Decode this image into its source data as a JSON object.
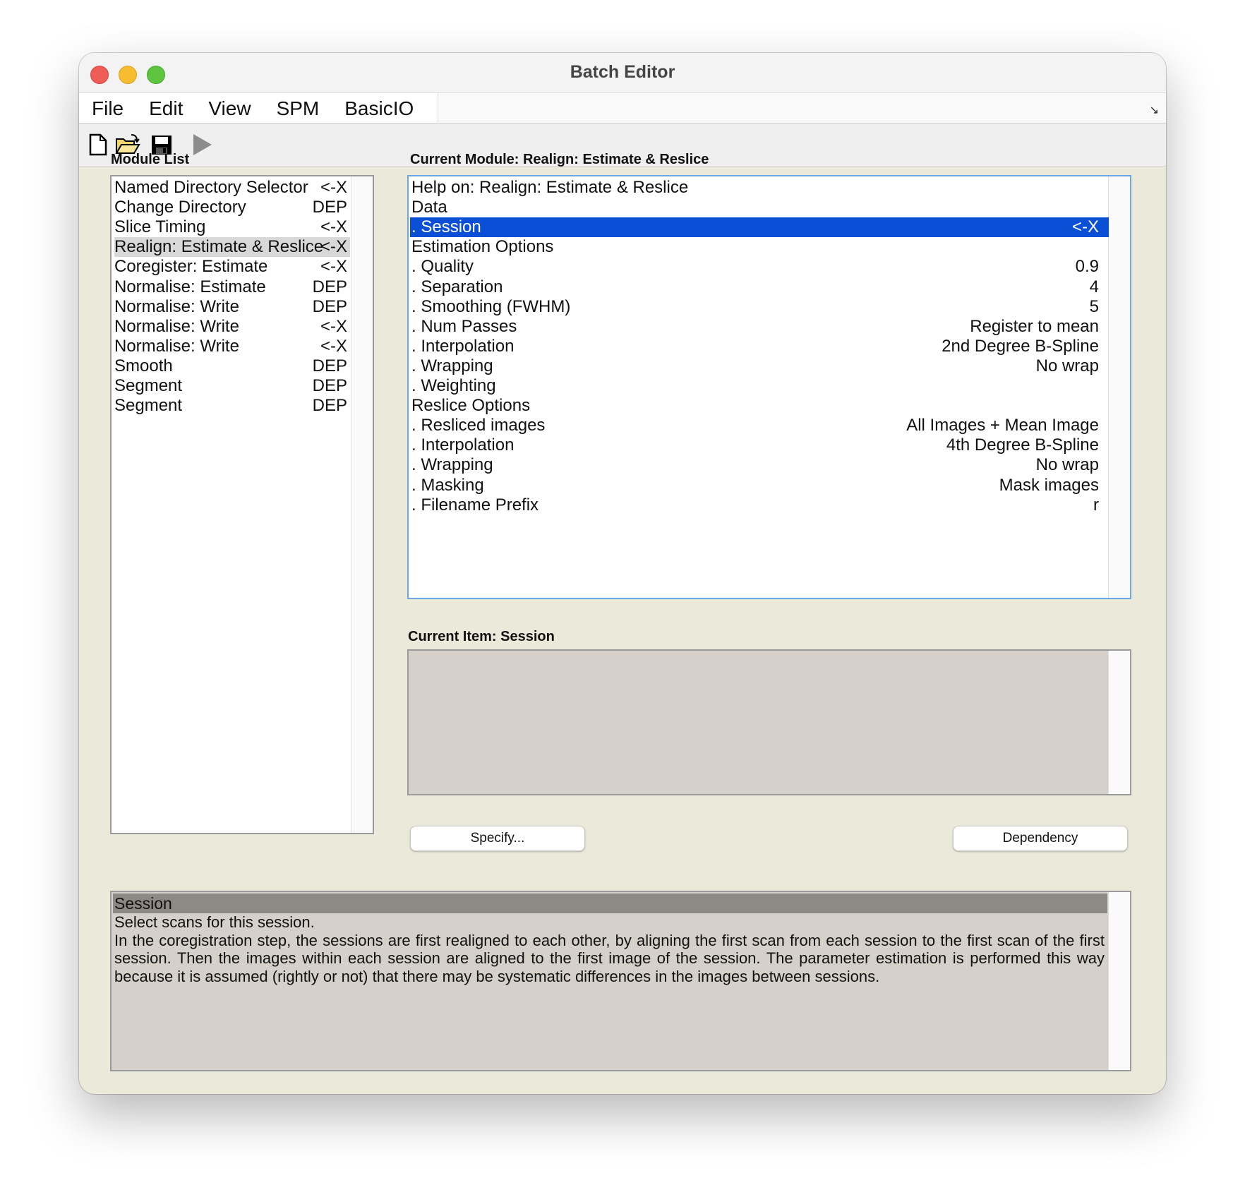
{
  "window": {
    "title": "Batch Editor"
  },
  "menubar": {
    "items": [
      "File",
      "Edit",
      "View",
      "SPM",
      "BasicIO"
    ]
  },
  "toolbar": {
    "buttons": [
      "new-file-icon",
      "open-folder-icon",
      "save-disk-icon",
      "run-play-icon"
    ]
  },
  "module_list": {
    "heading": "Module List",
    "items": [
      {
        "name": "Named Directory Selector",
        "status": "<-X"
      },
      {
        "name": "Change Directory",
        "status": "DEP"
      },
      {
        "name": "Slice Timing",
        "status": "<-X"
      },
      {
        "name": "Realign: Estimate & Reslice",
        "status": "<-X",
        "selected": true
      },
      {
        "name": "Coregister: Estimate",
        "status": "<-X"
      },
      {
        "name": "Normalise: Estimate",
        "status": "DEP"
      },
      {
        "name": "Normalise: Write",
        "status": "DEP"
      },
      {
        "name": "Normalise: Write",
        "status": "<-X"
      },
      {
        "name": "Normalise: Write",
        "status": "<-X"
      },
      {
        "name": "Smooth",
        "status": "DEP"
      },
      {
        "name": "Segment",
        "status": "DEP"
      },
      {
        "name": "Segment",
        "status": "DEP"
      }
    ]
  },
  "current_module": {
    "heading": "Current Module: Realign: Estimate & Reslice",
    "rows": [
      {
        "label": "Help on: Realign: Estimate & Reslice",
        "value": ""
      },
      {
        "label": "Data",
        "value": ""
      },
      {
        "label": ". Session",
        "value": "<-X",
        "selected": true
      },
      {
        "label": "Estimation Options",
        "value": ""
      },
      {
        "label": ". Quality",
        "value": "0.9"
      },
      {
        "label": ". Separation",
        "value": "4"
      },
      {
        "label": ". Smoothing (FWHM)",
        "value": "5"
      },
      {
        "label": ". Num Passes",
        "value": "Register to mean"
      },
      {
        "label": ". Interpolation",
        "value": "2nd Degree B-Spline"
      },
      {
        "label": ". Wrapping",
        "value": "No wrap"
      },
      {
        "label": ". Weighting",
        "value": ""
      },
      {
        "label": "Reslice Options",
        "value": ""
      },
      {
        "label": ". Resliced images",
        "value": "All Images + Mean Image"
      },
      {
        "label": ". Interpolation",
        "value": "4th Degree B-Spline"
      },
      {
        "label": ". Wrapping",
        "value": "No wrap"
      },
      {
        "label": ". Masking",
        "value": "Mask images"
      },
      {
        "label": ". Filename Prefix",
        "value": "r"
      }
    ]
  },
  "current_item": {
    "heading": "Current Item: Session"
  },
  "buttons": {
    "specify": "Specify...",
    "dependency": "Dependency"
  },
  "help": {
    "title": "Session",
    "paragraphs": [
      "Select scans for this session.",
      "In the coregistration step, the sessions are first realigned to each other, by aligning the first scan from each session to the first scan of the first session.  Then the images within each session are aligned to the first image of the session. The parameter estimation is performed this way because it is assumed (rightly or not) that there may be systematic differences in the images between sessions."
    ]
  },
  "colors": {
    "selection_blue": "#0a4fd6",
    "window_bg": "#ebe9da",
    "help_header": "#8d8a85"
  }
}
